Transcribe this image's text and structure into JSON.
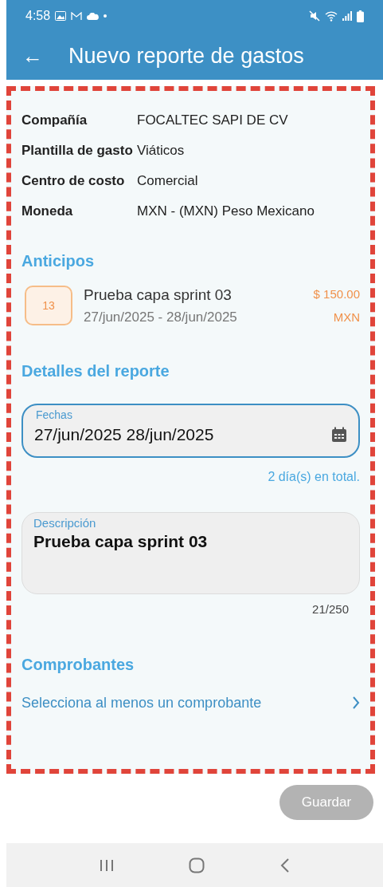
{
  "status_bar": {
    "time": "4:58"
  },
  "app_bar": {
    "back": "←",
    "title": "Nuevo reporte de gastos"
  },
  "details": [
    {
      "label": "Compañía",
      "value": "FOCALTEC SAPI DE CV"
    },
    {
      "label": "Plantilla de gasto",
      "value": "Viáticos"
    },
    {
      "label": "Centro de costo",
      "value": "Comercial"
    },
    {
      "label": "Moneda",
      "value": "MXN - (MXN) Peso Mexicano"
    }
  ],
  "advances": {
    "heading": "Anticipos",
    "items": [
      {
        "badge": "13",
        "title": "Prueba capa sprint 03",
        "dates": "27/jun/2025 - 28/jun/2025",
        "amount": "$ 150.00",
        "currency": "MXN"
      }
    ]
  },
  "report": {
    "heading": "Detalles del reporte",
    "dates_field": {
      "label": "Fechas",
      "value": "27/jun/2025 28/jun/2025",
      "focused": true
    },
    "days_total": "2 día(s) en total.",
    "description_field": {
      "label": "Descripción",
      "value": "Prueba capa sprint 03",
      "focused": false
    },
    "char_count": "21/250"
  },
  "receipts": {
    "heading": "Comprobantes",
    "link": "Selecciona al menos un comprobante"
  },
  "save_button": {
    "label": "Guardar",
    "disabled": true
  }
}
